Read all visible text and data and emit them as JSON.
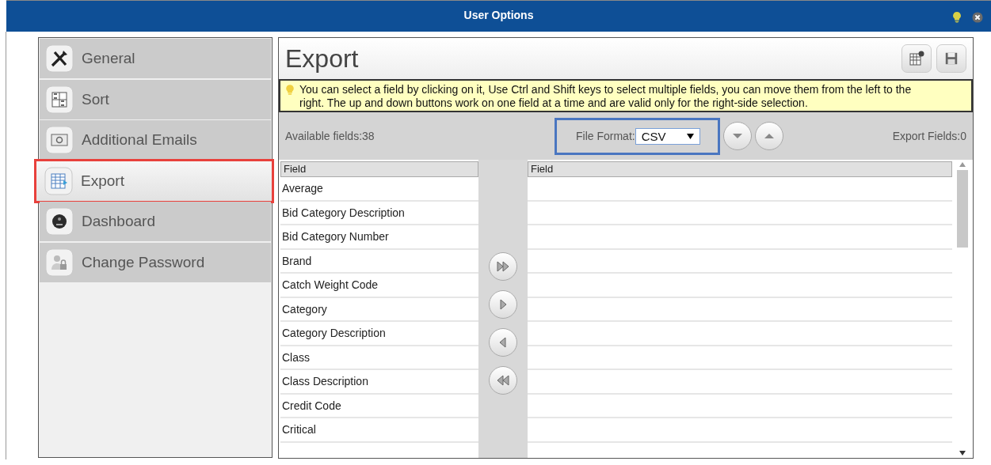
{
  "window": {
    "title": "User Options"
  },
  "sidebar": {
    "items": [
      {
        "label": "General",
        "selected": false
      },
      {
        "label": "Sort",
        "selected": false
      },
      {
        "label": "Additional Emails",
        "selected": false
      },
      {
        "label": "Export",
        "selected": true
      },
      {
        "label": "Dashboard",
        "selected": false
      },
      {
        "label": "Change Password",
        "selected": false
      }
    ]
  },
  "panel": {
    "title": "Export",
    "hint": "You can select a field by clicking on it, Use Ctrl and Shift keys to select multiple fields, you can move them from the left to the right. The up and down buttons work on one field at a time and are valid only for the right-side selection.",
    "available_fields": "Available fields:38",
    "file_format": {
      "label": "File Format:",
      "value": "CSV",
      "highlighted": true
    },
    "export_fields": "Export Fields:0",
    "left_table": {
      "header": "Field",
      "rows": [
        "Average",
        "Bid Category Description",
        "Bid Category Number",
        "Brand",
        "Catch Weight Code",
        "Category",
        "Category Description",
        "Class",
        "Class Description",
        "Credit Code",
        "Critical"
      ]
    },
    "right_table": {
      "header": "Field"
    }
  }
}
